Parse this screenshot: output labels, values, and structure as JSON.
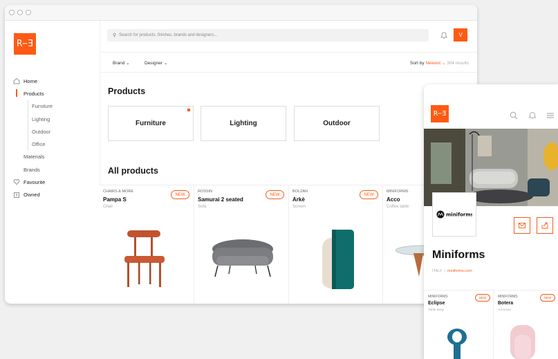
{
  "app": {
    "logo_text": "R−Ǝ",
    "accent": "#ff5a13"
  },
  "sidebar": {
    "items": [
      {
        "label": "Home"
      },
      {
        "label": "Products"
      },
      {
        "label": "Furniture"
      },
      {
        "label": "Lighting"
      },
      {
        "label": "Outdoor"
      },
      {
        "label": "Office"
      },
      {
        "label": "Materials"
      },
      {
        "label": "Brands"
      },
      {
        "label": "Favourite"
      },
      {
        "label": "Owned"
      }
    ]
  },
  "header": {
    "search_placeholder": "Search for products, finishes, brands and designers...",
    "avatar_initial": "V"
  },
  "filters": {
    "brand_label": "Brand",
    "designer_label": "Designer",
    "sort_prefix": "Sort by",
    "sort_value": "Newest",
    "results": "304 results"
  },
  "main": {
    "products_heading": "Products",
    "categories": [
      {
        "label": "Furniture"
      },
      {
        "label": "Lighting"
      },
      {
        "label": "Outdoor"
      }
    ],
    "all_heading": "All products",
    "cards": [
      {
        "brand": "CHAIRS & MORE",
        "name": "Pampa S",
        "type": "Chair",
        "badge": "NEW"
      },
      {
        "brand": "ROSSIN",
        "name": "Samurai 2 seated",
        "type": "Sofa",
        "badge": "NEW"
      },
      {
        "brand": "BOLZAN",
        "name": "Arkè",
        "type": "Screen",
        "badge": "NEW"
      },
      {
        "brand": "MINIFORMS",
        "name": "Acco",
        "type": "Coffee table",
        "badge": ""
      }
    ]
  },
  "mobile": {
    "logo_text": "R−Ǝ",
    "brand_logo_text": "miniforms",
    "brand_name": "Miniforms",
    "country": "ITALY",
    "website": "miniforms.com",
    "cards": [
      {
        "brand": "MINIFORMS",
        "name": "Eclipse",
        "type": "Table lamp",
        "badge": "NEW"
      },
      {
        "brand": "MINIFORMS",
        "name": "Botera",
        "type": "Armchair",
        "badge": "NEW"
      }
    ]
  }
}
